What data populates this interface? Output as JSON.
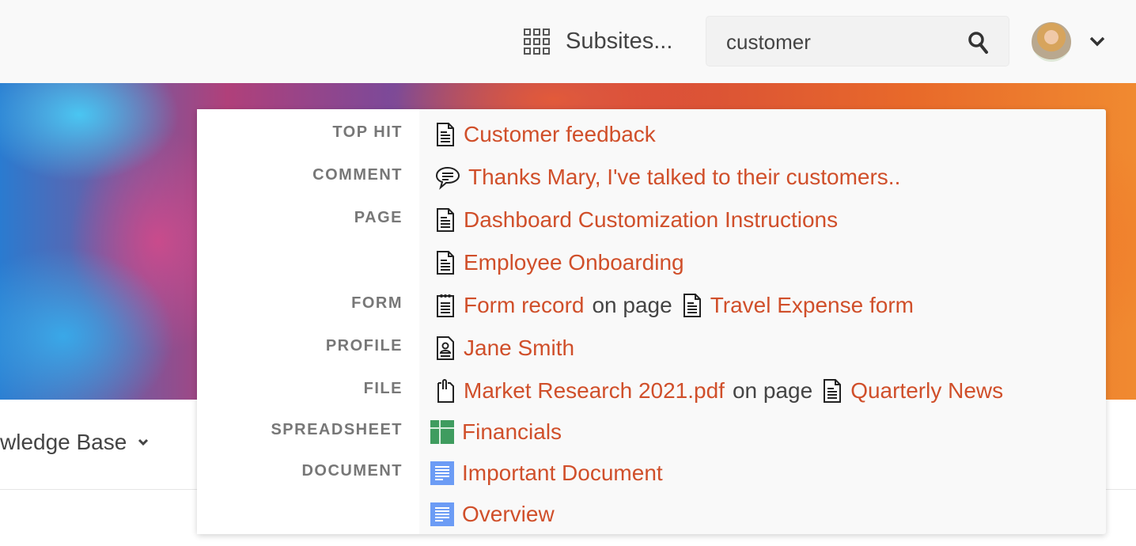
{
  "header": {
    "subsites_label": "Subsites...",
    "search": {
      "value": "customer",
      "icon": "search-icon"
    },
    "avatar": "user-avatar",
    "menu_caret": "chevron-down-icon"
  },
  "page": {
    "breadcrumb_label": "wledge Base"
  },
  "colors": {
    "link": "#d04f2a",
    "label": "#777777",
    "sheet": "#3f9c5f",
    "doc": "#6c9cf5"
  },
  "results": [
    {
      "label": "TOP HIT",
      "parts": [
        {
          "icon": "page-icon"
        },
        {
          "link": "Customer feedback"
        }
      ]
    },
    {
      "label": "COMMENT",
      "parts": [
        {
          "icon": "comment-icon"
        },
        {
          "link": "Thanks Mary, I've talked to their customers.."
        }
      ]
    },
    {
      "label": "PAGE",
      "parts": [
        {
          "icon": "page-icon"
        },
        {
          "link": "Dashboard Customization Instructions"
        }
      ]
    },
    {
      "label": "",
      "parts": [
        {
          "icon": "page-icon"
        },
        {
          "link": "Employee Onboarding"
        }
      ]
    },
    {
      "label": "FORM",
      "parts": [
        {
          "icon": "form-icon"
        },
        {
          "link": "Form record"
        },
        {
          "text": "on page"
        },
        {
          "icon": "page-icon"
        },
        {
          "link": "Travel Expense form"
        }
      ]
    },
    {
      "label": "PROFILE",
      "parts": [
        {
          "icon": "profile-icon"
        },
        {
          "link": "Jane Smith"
        }
      ]
    },
    {
      "label": "FILE",
      "parts": [
        {
          "icon": "file-icon"
        },
        {
          "link": "Market Research 2021.pdf"
        },
        {
          "text": "on page"
        },
        {
          "icon": "page-icon"
        },
        {
          "link": "Quarterly News"
        }
      ]
    },
    {
      "label": "SPREADSHEET",
      "parts": [
        {
          "icon": "spreadsheet-icon"
        },
        {
          "link": "Financials"
        }
      ]
    },
    {
      "label": "DOCUMENT",
      "parts": [
        {
          "icon": "document-icon"
        },
        {
          "link": "Important Document"
        }
      ]
    },
    {
      "label": "",
      "parts": [
        {
          "icon": "document-icon"
        },
        {
          "link": "Overview"
        }
      ]
    }
  ]
}
